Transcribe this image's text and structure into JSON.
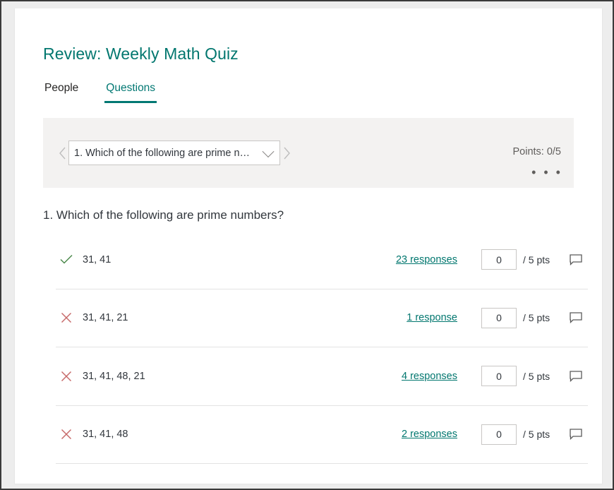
{
  "window": {
    "accent_color": "#027873"
  },
  "header": {
    "title": "Review: Weekly Math Quiz"
  },
  "tabs": [
    {
      "label": "People",
      "active": false
    },
    {
      "label": "Questions",
      "active": true
    }
  ],
  "nav_panel": {
    "prev_icon": "chevron-left-icon",
    "next_icon": "chevron-right-icon",
    "selected_question": "1. Which of the following are prime num...",
    "dropdown_icon": "chevron-down-icon",
    "points_label": "Points: 0/5",
    "more_label": "• • •"
  },
  "question": {
    "text": "1. Which of the following are prime numbers?",
    "answers": [
      {
        "mark": "check-icon",
        "correct": true,
        "label": "31, 41",
        "responses_label": "23 responses",
        "score_value": "0",
        "points_label": "/ 5 pts",
        "comment_icon": "comment-icon"
      },
      {
        "mark": "cross-icon",
        "correct": false,
        "label": "31, 41, 21",
        "responses_label": "1 response",
        "score_value": "0",
        "points_label": "/ 5 pts",
        "comment_icon": "comment-icon"
      },
      {
        "mark": "cross-icon",
        "correct": false,
        "label": "31, 41, 48, 21",
        "responses_label": "4 responses",
        "score_value": "0",
        "points_label": "/ 5 pts",
        "comment_icon": "comment-icon"
      },
      {
        "mark": "cross-icon",
        "correct": false,
        "label": "31, 41, 48",
        "responses_label": "2 responses",
        "score_value": "0",
        "points_label": "/ 5 pts",
        "comment_icon": "comment-icon"
      }
    ]
  },
  "colors": {
    "teal": "#027873",
    "link": "#02776f",
    "check": "#4c8a4c",
    "cross": "#c76a6a",
    "panel_bg": "#f3f2f1"
  }
}
